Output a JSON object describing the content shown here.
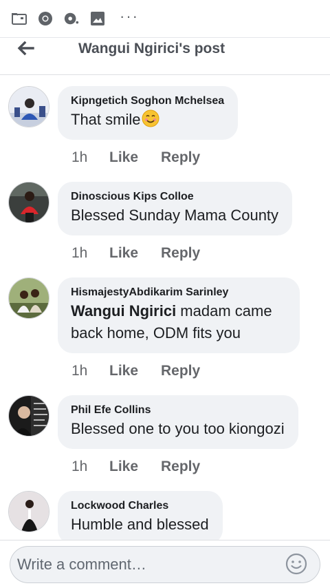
{
  "status_bar": {
    "icons": [
      "folder-icon",
      "chrome-icon",
      "vpn-icon",
      "image-icon"
    ],
    "more": "···"
  },
  "header": {
    "title": "Wangui Ngirici's post",
    "back_icon": "arrow-left-icon"
  },
  "comments": [
    {
      "author": "Kipngetich Soghon Mchelsea",
      "mention": "",
      "text": "That smile",
      "emoji": "smiling-face-emoji",
      "time": "1h",
      "like": "Like",
      "reply": "Reply"
    },
    {
      "author": "Dinoscious Kips Colloe",
      "mention": "",
      "text": "Blessed Sunday Mama County",
      "emoji": "",
      "time": "1h",
      "like": "Like",
      "reply": "Reply"
    },
    {
      "author": "HismajestyAbdikarim Sarinley",
      "mention": "Wangui Ngirici",
      "text": " madam came back home, ODM fits you",
      "emoji": "",
      "time": "1h",
      "like": "Like",
      "reply": "Reply"
    },
    {
      "author": "Phil Efe Collins",
      "mention": "",
      "text": "Blessed one to you too kiongozi",
      "emoji": "",
      "time": "1h",
      "like": "Like",
      "reply": "Reply"
    },
    {
      "author": "Lockwood Charles",
      "mention": "",
      "text": "Humble and blessed",
      "emoji": "",
      "time": "",
      "like": "",
      "reply": ""
    }
  ],
  "composer": {
    "placeholder": "Write a comment…",
    "emoji_icon": "smiley-icon"
  },
  "colors": {
    "bubble": "#f0f2f5",
    "meta": "#65676b",
    "header_title": "#4b4f56"
  }
}
